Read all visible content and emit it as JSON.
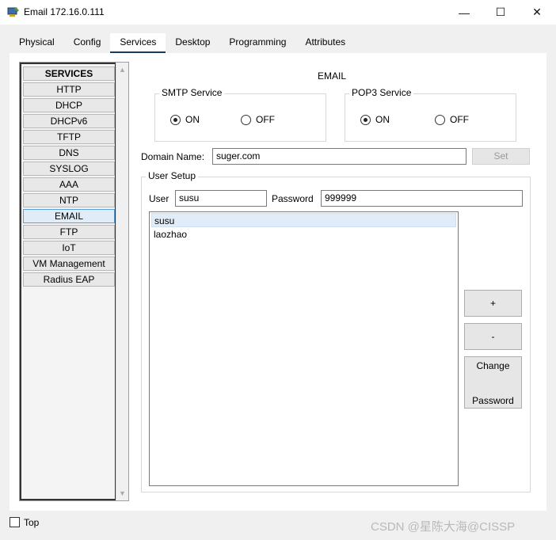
{
  "window": {
    "title": "Email 172.16.0.111",
    "app_icon": "packet-tracer-pc-icon",
    "controls": {
      "minimize": "—",
      "maximize": "☐",
      "close": "✕"
    }
  },
  "tabs": [
    {
      "label": "Physical",
      "active": false
    },
    {
      "label": "Config",
      "active": false
    },
    {
      "label": "Services",
      "active": true
    },
    {
      "label": "Desktop",
      "active": false
    },
    {
      "label": "Programming",
      "active": false
    },
    {
      "label": "Attributes",
      "active": false
    }
  ],
  "services": {
    "header": "SERVICES",
    "items": [
      "HTTP",
      "DHCP",
      "DHCPv6",
      "TFTP",
      "DNS",
      "SYSLOG",
      "AAA",
      "NTP",
      "EMAIL",
      "FTP",
      "IoT",
      "VM Management",
      "Radius EAP"
    ],
    "selected": "EMAIL"
  },
  "email": {
    "title": "EMAIL",
    "smtp": {
      "label": "SMTP Service",
      "on_label": "ON",
      "off_label": "OFF",
      "value": "ON"
    },
    "pop3": {
      "label": "POP3 Service",
      "on_label": "ON",
      "off_label": "OFF",
      "value": "ON"
    },
    "domain": {
      "label": "Domain Name:",
      "value": "suger.com",
      "set_label": "Set"
    },
    "user_setup": {
      "label": "User Setup",
      "user_label": "User",
      "user_value": "susu",
      "password_label": "Password",
      "password_value": "999999",
      "users": [
        "susu",
        "laozhao"
      ],
      "selected_user": "susu",
      "add_label": "+",
      "remove_label": "-",
      "change_label_1": "Change",
      "change_label_2": "Password"
    }
  },
  "footer": {
    "top_label": "Top",
    "top_checked": false,
    "watermark": "CSDN @星陈大海@CISSP"
  },
  "colors": {
    "active_tab_underline": "#1b3a5c",
    "selection": "#e0ecf8"
  }
}
